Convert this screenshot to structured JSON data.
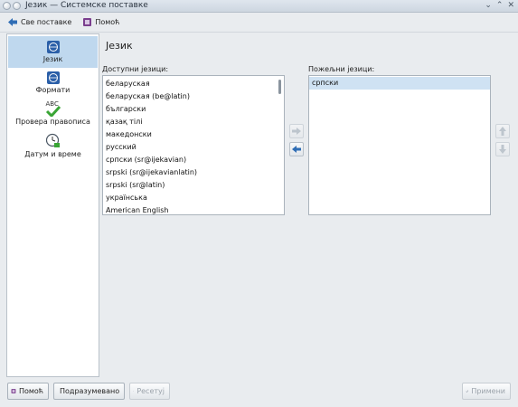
{
  "window": {
    "title": "Језик — Системске поставке"
  },
  "toolbar": {
    "all_settings_label": "Све поставке",
    "help_label": "Помоћ"
  },
  "sidebar": {
    "items": [
      {
        "label": "Језик"
      },
      {
        "label": "Формати"
      },
      {
        "label": "Провера правописа",
        "icon_text": "ABC"
      },
      {
        "label": "Датум и време"
      }
    ]
  },
  "main": {
    "title": "Језик",
    "available_label": "Доступни језици:",
    "preferred_label": "Пожељни језици:",
    "available_languages": [
      "беларуская",
      "беларуская (be@latin)",
      "български",
      "қазақ тілі",
      "македонски",
      "русский",
      "српски (sr@ijekavian)",
      "srpski (sr@ijekavianlatin)",
      "srpski (sr@latin)",
      "українська",
      "American English"
    ],
    "preferred_languages": [
      "српски"
    ]
  },
  "footer": {
    "help_label": "Помоћ",
    "defaults_label": "Подразумевано",
    "reset_label": "Ресетуј",
    "apply_label": "Примени"
  },
  "colors": {
    "accent": "#bfd8ee",
    "selection": "#cfe2f3",
    "arrow_blue": "#2f6db5"
  }
}
